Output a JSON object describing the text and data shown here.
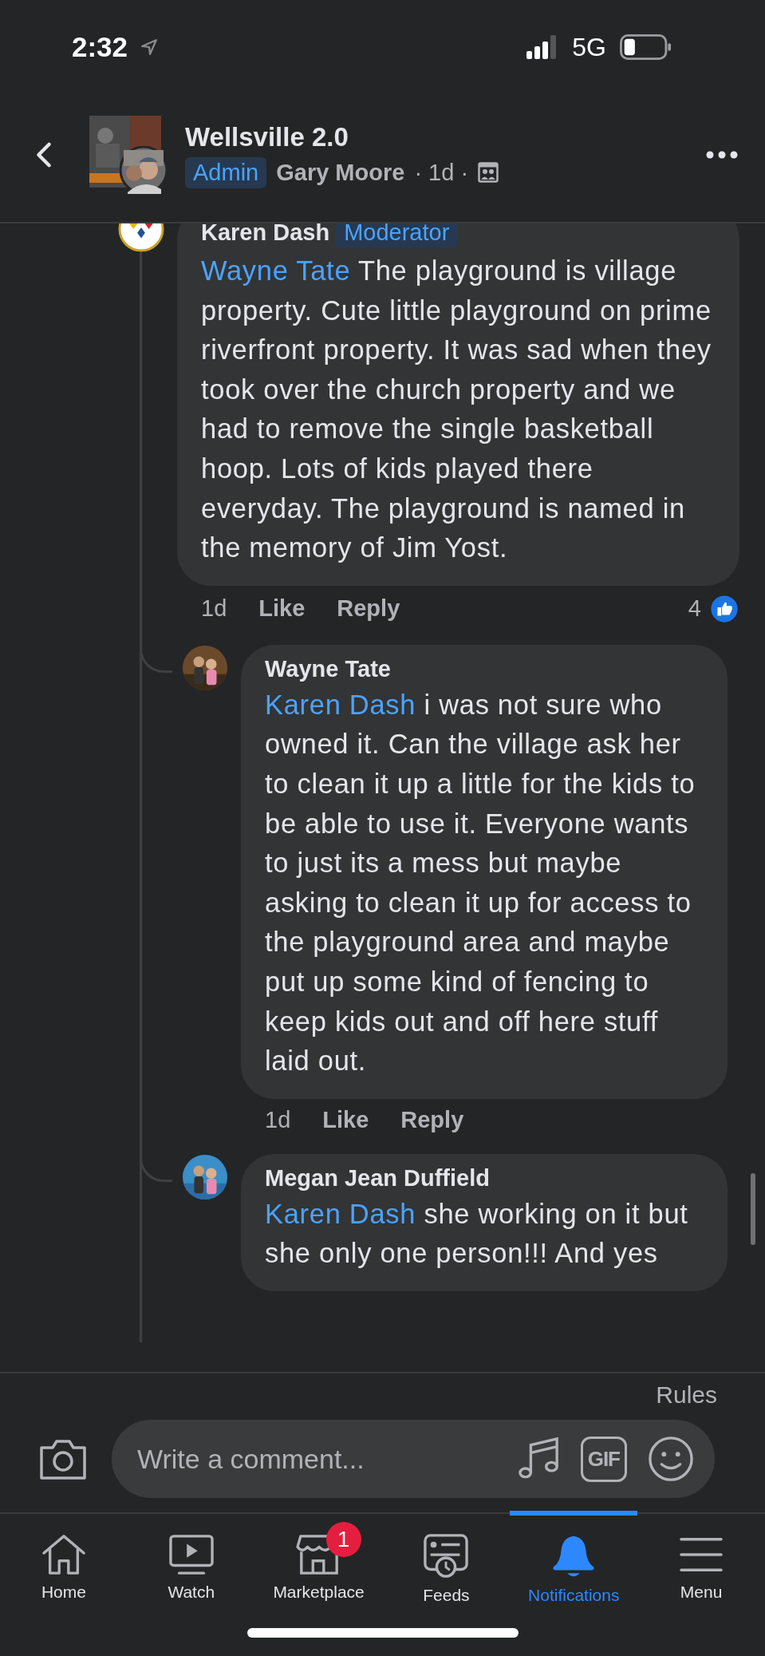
{
  "status_bar": {
    "time": "2:32",
    "network": "5G"
  },
  "header": {
    "title": "Wellsville 2.0",
    "badge": "Admin",
    "author": "Gary Moore",
    "meta": "· 1d ·"
  },
  "comments": [
    {
      "reply": false,
      "kind": "logo",
      "author": "Karen Dash",
      "badge": "Moderator",
      "mention": "Wayne Tate",
      "text": "The playground is village property. Cute little playground on prime riverfront property. It was sad when they took over the church property and we had to remove the single basketball hoop. Lots of kids played there everyday. The playground is named in the memory of Jim Yost.",
      "time": "1d",
      "like": "Like",
      "reply_label": "Reply",
      "reaction_count": "4"
    },
    {
      "reply": true,
      "author": "Wayne Tate",
      "mention": "Karen Dash",
      "text": "i was not sure who owned it. Can the village ask her to clean it up a little for the kids to be able to use it. Everyone wants to just its a mess but maybe asking to clean it up for access to the playground area and maybe put up some kind of fencing to keep kids out and off here stuff laid out.",
      "time": "1d",
      "like": "Like",
      "reply_label": "Reply"
    },
    {
      "reply": true,
      "author": "Megan Jean Duffield",
      "mention": "Karen Dash",
      "text": "she working on it but she only one person!!! And yes"
    }
  ],
  "composer": {
    "rules": "Rules",
    "placeholder": "Write a comment...",
    "gif": "GIF"
  },
  "tabs": [
    {
      "kind": "home",
      "label": "Home",
      "selected": false
    },
    {
      "kind": "watch",
      "label": "Watch",
      "selected": false
    },
    {
      "kind": "marketplace",
      "label": "Marketplace",
      "selected": false,
      "badge": "1"
    },
    {
      "kind": "feeds",
      "label": "Feeds",
      "selected": false
    },
    {
      "kind": "notifications",
      "label": "Notifications",
      "selected": true
    },
    {
      "kind": "menu",
      "label": "Menu",
      "selected": false
    }
  ]
}
